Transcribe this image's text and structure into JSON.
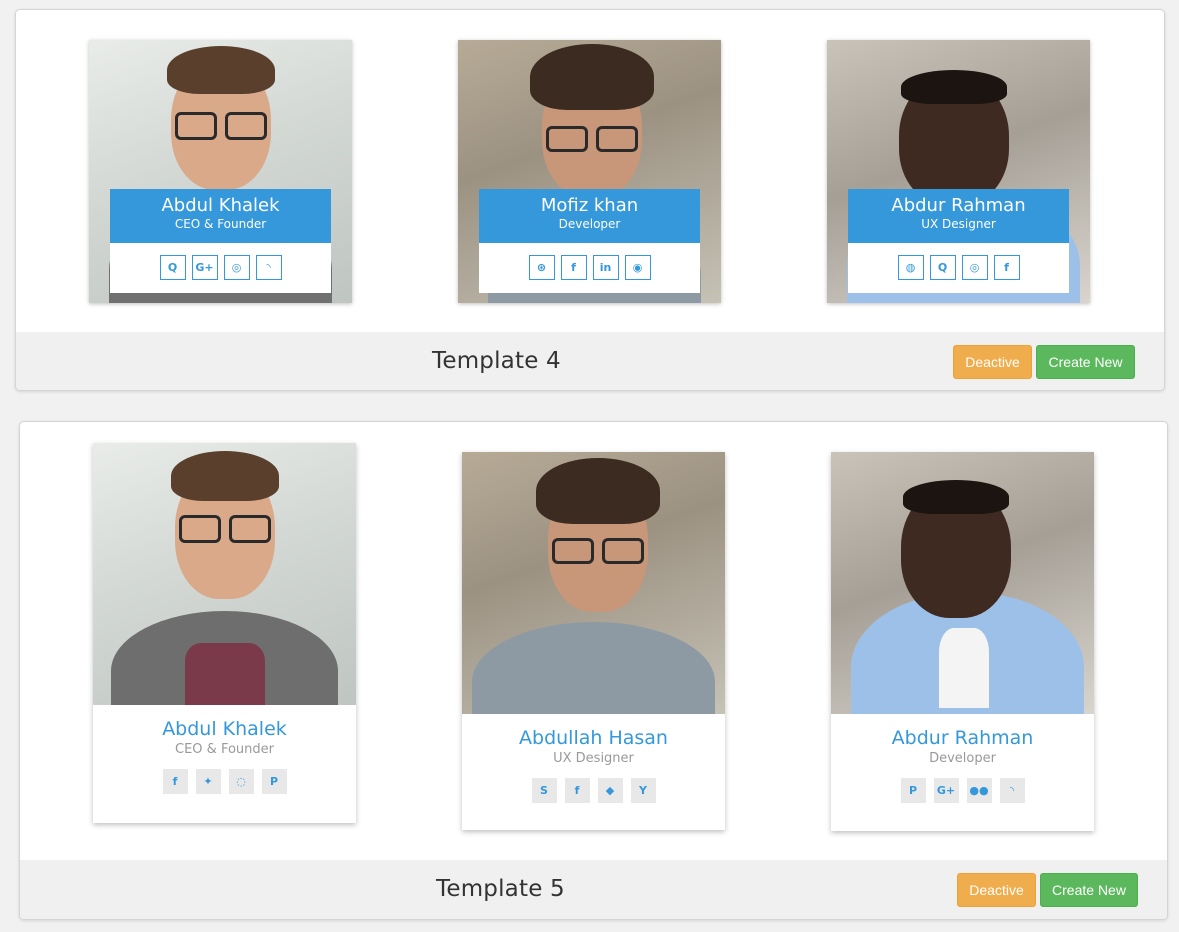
{
  "templates": [
    {
      "title": "Template 4",
      "deactive_label": "Deactive",
      "create_label": "Create New",
      "members": [
        {
          "name": "Abdul Khalek",
          "role": "CEO & Founder",
          "icons": [
            {
              "name": "quora-icon",
              "glyph": "Q"
            },
            {
              "name": "google-plus-icon",
              "glyph": "G+"
            },
            {
              "name": "instagram-icon",
              "glyph": "◎"
            },
            {
              "name": "rss-icon",
              "glyph": "◝"
            }
          ]
        },
        {
          "name": "Mofiz khan",
          "role": "Developer",
          "icons": [
            {
              "name": "dribbble-icon",
              "glyph": "⊛"
            },
            {
              "name": "facebook-icon",
              "glyph": "f"
            },
            {
              "name": "linkedin-icon",
              "glyph": "in"
            },
            {
              "name": "reddit-icon",
              "glyph": "◉"
            }
          ]
        },
        {
          "name": "Abdur Rahman",
          "role": "UX Designer",
          "icons": [
            {
              "name": "wechat-icon",
              "glyph": "◍"
            },
            {
              "name": "quora-icon",
              "glyph": "Q"
            },
            {
              "name": "instagram-icon",
              "glyph": "◎"
            },
            {
              "name": "facebook-icon",
              "glyph": "f"
            }
          ]
        }
      ]
    },
    {
      "title": "Template 5",
      "deactive_label": "Deactive",
      "create_label": "Create New",
      "members": [
        {
          "name": "Abdul Khalek",
          "role": "CEO & Founder",
          "icons": [
            {
              "name": "facebook-icon",
              "glyph": "f"
            },
            {
              "name": "twitter-icon",
              "glyph": "✦"
            },
            {
              "name": "whatsapp-icon",
              "glyph": "◌"
            },
            {
              "name": "pinterest-icon",
              "glyph": "P"
            }
          ]
        },
        {
          "name": "Abdullah Hasan",
          "role": "UX Designer",
          "icons": [
            {
              "name": "skype-icon",
              "glyph": "S"
            },
            {
              "name": "facebook-icon",
              "glyph": "f"
            },
            {
              "name": "dropbox-icon",
              "glyph": "◆"
            },
            {
              "name": "ycombinator-icon",
              "glyph": "Y"
            }
          ]
        },
        {
          "name": "Abdur Rahman",
          "role": "Developer",
          "icons": [
            {
              "name": "pinterest-icon",
              "glyph": "P"
            },
            {
              "name": "google-plus-icon",
              "glyph": "G+"
            },
            {
              "name": "flickr-icon",
              "glyph": "●●"
            },
            {
              "name": "rss-icon",
              "glyph": "◝"
            }
          ]
        }
      ]
    }
  ],
  "colors": {
    "accent": "#3498db",
    "deactive": "#f0ad4e",
    "create": "#5cb85c"
  }
}
